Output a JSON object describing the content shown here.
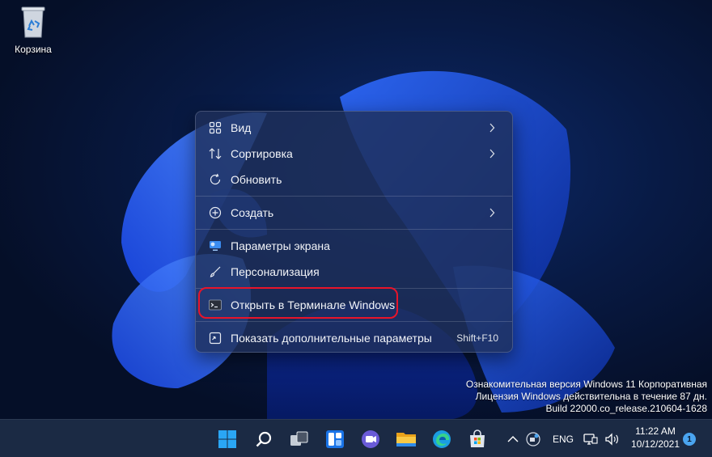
{
  "desktop": {
    "recycle_bin_label": "Корзина"
  },
  "context_menu": {
    "items": [
      {
        "label": "Вид",
        "icon": "grid-icon",
        "submenu": true
      },
      {
        "label": "Сортировка",
        "icon": "sort-icon",
        "submenu": true
      },
      {
        "label": "Обновить",
        "icon": "refresh-icon",
        "submenu": false
      },
      {
        "label": "Создать",
        "icon": "plus-circle-icon",
        "submenu": true
      },
      {
        "label": "Параметры экрана",
        "icon": "display-settings-icon",
        "submenu": false
      },
      {
        "label": "Персонализация",
        "icon": "brush-icon",
        "submenu": false
      },
      {
        "label": "Открыть в Терминале Windows",
        "icon": "terminal-icon",
        "submenu": false,
        "highlighted": true
      },
      {
        "label": "Показать дополнительные параметры",
        "icon": "more-options-icon",
        "shortcut": "Shift+F10"
      }
    ],
    "highlight_color": "#e8142a"
  },
  "watermark": {
    "line1": "Ознакомительная версия Windows 11 Корпоративная",
    "line2": "Лицензия Windows действительна в течение 87 дн.",
    "line3": "Build 22000.co_release.210604-1628"
  },
  "taskbar": {
    "apps": [
      "start-icon",
      "search-icon",
      "task-view-icon",
      "widgets-icon",
      "chat-icon",
      "file-explorer-icon",
      "edge-icon",
      "store-icon"
    ],
    "language": "ENG",
    "time": "11:22 AM",
    "date": "10/12/2021",
    "notification_count": "1"
  },
  "colors": {
    "accent": "#1a5bff",
    "menu_bg": "#1e305a",
    "taskbar_bg": "#1b2a44"
  }
}
